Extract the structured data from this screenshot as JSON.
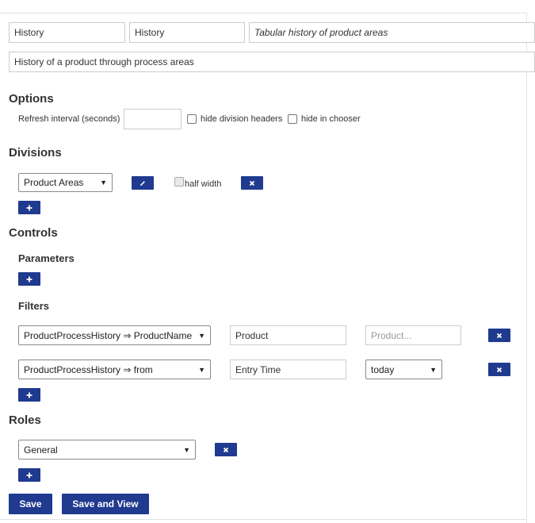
{
  "header": {
    "name_value": "History",
    "title_value": "History",
    "subtitle_value": "Tabular history of product areas",
    "description_value": "History of a product through process areas"
  },
  "options": {
    "heading": "Options",
    "refresh_label": "Refresh interval (seconds)",
    "refresh_value": "",
    "hide_division_headers_label": "hide division headers",
    "hide_division_headers_checked": false,
    "hide_in_chooser_label": "hide in chooser",
    "hide_in_chooser_checked": false
  },
  "divisions": {
    "heading": "Divisions",
    "items": [
      {
        "selected": "Product Areas",
        "half_width_label": "half width",
        "half_width_checked": false
      }
    ]
  },
  "controls": {
    "heading": "Controls",
    "parameters_heading": "Parameters",
    "filters_heading": "Filters",
    "filters": [
      {
        "field": "ProductProcessHistory ⇒ ProductName",
        "label": "Product",
        "value_placeholder": "Product..."
      },
      {
        "field": "ProductProcessHistory ⇒ from",
        "label": "Entry Time",
        "value_select": "today"
      }
    ]
  },
  "roles": {
    "heading": "Roles",
    "items": [
      {
        "selected": "General"
      }
    ]
  },
  "actions": {
    "save_label": "Save",
    "save_and_view_label": "Save and View"
  },
  "colors": {
    "button_bg": "#1f3a8f",
    "border": "#cccccc"
  },
  "icons": {
    "add": "plus-icon",
    "edit": "pencil-icon",
    "remove": "close-icon"
  }
}
